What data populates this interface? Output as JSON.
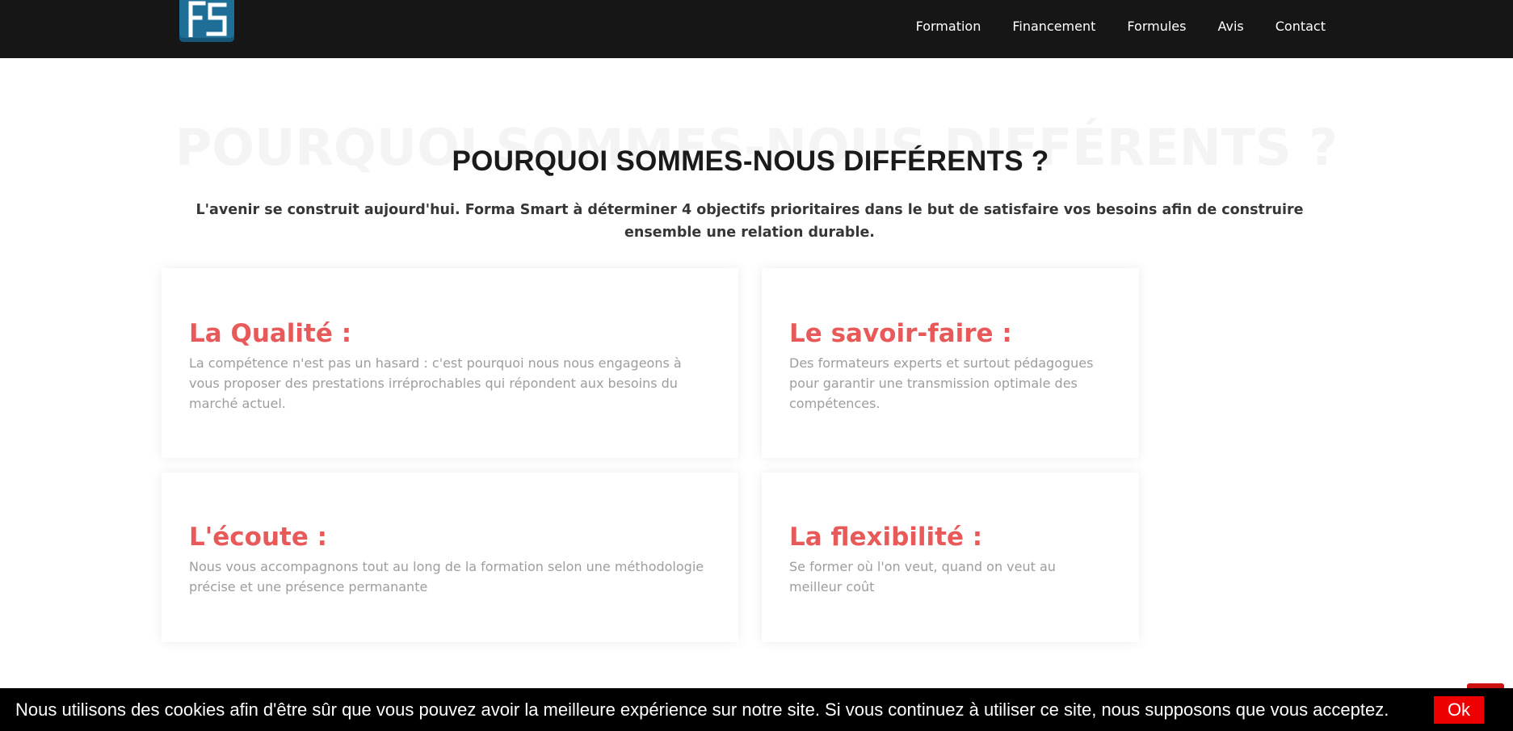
{
  "header": {
    "logo_text": "FS",
    "nav": [
      {
        "label": "Formation"
      },
      {
        "label": "Financement"
      },
      {
        "label": "Formules"
      },
      {
        "label": "Avis"
      },
      {
        "label": "Contact"
      }
    ]
  },
  "section": {
    "watermark": "POURQUOI SOMMES-NOUS DIFFÉRENTS ?",
    "title": "POURQUOI SOMMES-NOUS DIFFÉRENTS ?",
    "intro": "L'avenir se construit aujourd'hui. Forma Smart à déterminer 4 objectifs prioritaires dans le but de satisfaire vos besoins afin de construire ensemble une relation durable."
  },
  "cards": [
    {
      "title": "La Qualité :",
      "text": "La compétence n'est pas un hasard : c'est pourquoi nous nous engageons à vous proposer des prestations irréprochables qui répondent aux besoins du marché actuel."
    },
    {
      "title": "Le savoir-faire :",
      "text": "Des formateurs experts et surtout pédagogues pour garantir une transmission optimale des compétences."
    },
    {
      "title": "L'écoute :",
      "text": "Nous vous accompagnons tout au long de la formation selon une méthodologie précise et une présence permanante"
    },
    {
      "title": "La flexibilité :",
      "text": "Se former où l'on veut, quand on veut au meilleur coût"
    }
  ],
  "cookie": {
    "message": "Nous utilisons des cookies afin d'être sûr que vous pouvez avoir la meilleure expérience sur notre site. Si vous continuez à utiliser ce site, nous supposons que vous acceptez.",
    "ok_label": "Ok"
  },
  "colors": {
    "topbar": "#161616",
    "logo": "#1e6e97",
    "accent": "#e85a5a",
    "cookie_button": "#ee0000"
  }
}
